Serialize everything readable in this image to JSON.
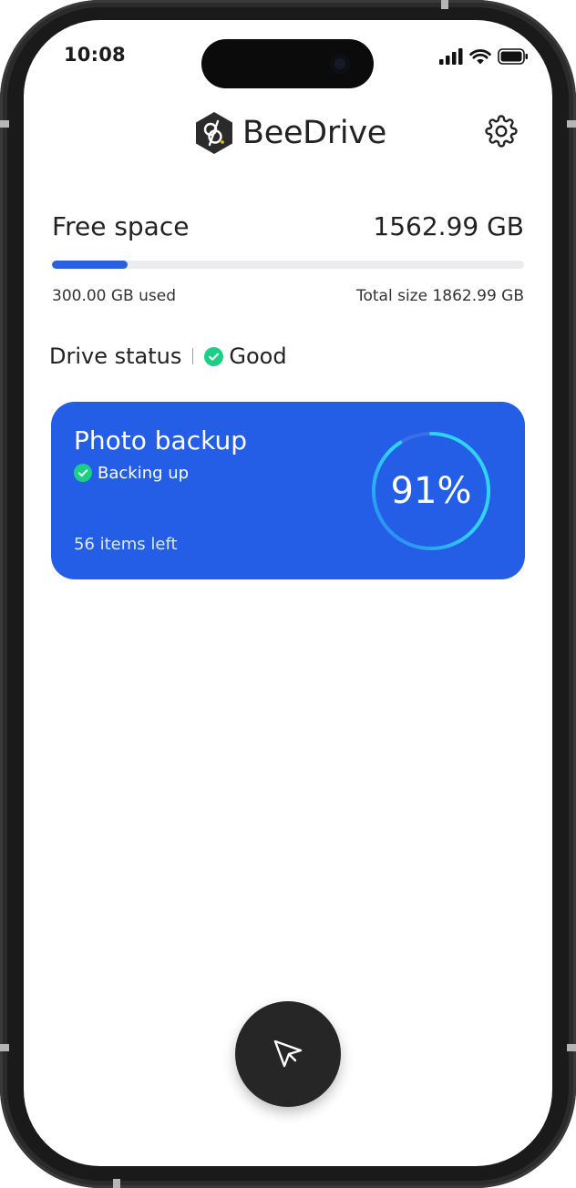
{
  "status_bar": {
    "time": "10:08",
    "icons": [
      "cellular-signal-icon",
      "wifi-icon",
      "battery-icon"
    ]
  },
  "header": {
    "brand_name": "BeeDrive",
    "logo_icon": "beedrive-logo-icon",
    "settings_icon": "gear-icon"
  },
  "storage": {
    "free_label": "Free space",
    "free_value": "1562.99 GB",
    "used_label": "300.00 GB used",
    "total_label": "Total size 1862.99 GB",
    "used_fraction": 0.161
  },
  "drive_status": {
    "label": "Drive status",
    "value": "Good",
    "icon": "check-circle-icon"
  },
  "backup_card": {
    "title": "Photo backup",
    "status": "Backing up",
    "status_icon": "check-circle-icon",
    "items_left": "56 items left",
    "progress_percent": 91,
    "progress_label": "91%"
  },
  "fab": {
    "icon": "send-cursor-icon"
  },
  "colors": {
    "accent": "#2a5fe0",
    "card_bg": "#245ee6",
    "success": "#1ccf86",
    "ring": "#2fd3f3",
    "fab_bg": "#262626"
  }
}
